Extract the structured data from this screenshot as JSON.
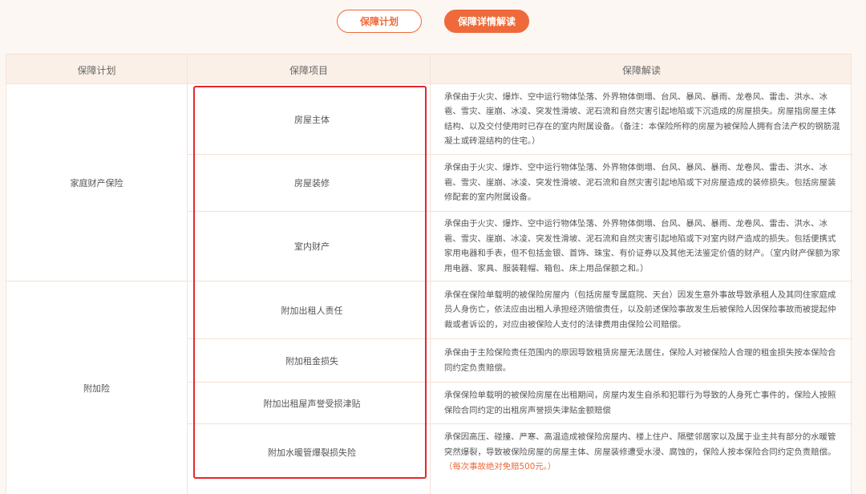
{
  "tabs": {
    "plan_label": "保障计划",
    "detail_label": "保障详情解读"
  },
  "table": {
    "headers": [
      "保障计划",
      "保障项目",
      "保障解读"
    ],
    "groups": [
      {
        "plan": "家庭财产保险"
      },
      {
        "plan": "附加险"
      }
    ],
    "rows": [
      {
        "item": "房屋主体",
        "desc": "承保由于火灾、爆炸、空中运行物体坠落、外界物体倒塌、台风、暴风、暴雨、龙卷风、雷击、洪水、冰雹、雪灾、崖崩、冰凌、突发性滑坡、泥石流和自然灾害引起地陷或下沉造成的房屋损失。房屋指房屋主体结构、以及交付使用时已存在的室内附属设备。（备注：本保险所称的房屋为被保险人拥有合法产权的钢筋混凝土或砖混结构的住宅。）"
      },
      {
        "item": "房屋装修",
        "desc": "承保由于火灾、爆炸、空中运行物体坠落、外界物体倒塌、台风、暴风、暴雨、龙卷风、雷击、洪水、冰雹、雪灾、崖崩、冰凌、突发性滑坡、泥石流和自然灾害引起地陷或下对房屋造成的装修损失。包括房屋装修配套的室内附属设备。"
      },
      {
        "item": "室内财产",
        "desc": "承保由于火灾、爆炸、空中运行物体坠落、外界物体倒塌、台风、暴风、暴雨、龙卷风、雷击、洪水、冰雹、雪灾、崖崩、冰凌、突发性滑坡、泥石流和自然灾害引起地陷或下对室内财产造成的损失。包括便携式家用电器和手表，但不包括金银、首饰、珠宝、有价证券以及其他无法鉴定价值的财产。（室内财产保额为家用电器、家具、服装鞋帽、箱包、床上用品保额之和。）"
      },
      {
        "item": "附加出租人责任",
        "desc": "承保在保险单载明的被保险房屋内（包括房屋专属庭院、天台）因发生意外事故导致承租人及其同住家庭成员人身伤亡，依法应由出租人承担经济赔偿责任，以及前述保险事故发生后被保险人因保险事故而被提起仲裁或者诉讼的，对应由被保险人支付的法律费用由保险公司赔偿。"
      },
      {
        "item": "附加租金损失",
        "desc": "承保由于主险保险责任范围内的原因导致租赁房屋无法居住，保险人对被保险人合理的租金损失按本保险合同约定负责赔偿。"
      },
      {
        "item": "附加出租屋声誉受损津贴",
        "desc": "承保保险单载明的被保险房屋在出租期间，房屋内发生自杀和犯罪行为导致的人身死亡事件的，保险人按照保险合同约定的出租房声誉损失津贴金额赔偿"
      },
      {
        "item": "附加水暖管爆裂损失险",
        "desc": "承保因高压、碰撞、严寒、高温造成被保险房屋内、楼上住户、隔壁邻居家以及属于业主共有部分的水暖管突然爆裂，导致被保险房屋的房屋主体、房屋装修遭受水浸、腐蚀的，保险人按本保险合同约定负责赔偿。",
        "note": "（每次事故绝对免赔500元。）"
      }
    ]
  },
  "colors": {
    "accent": "#ef6a3a",
    "highlight_box": "#e8262c",
    "header_bg": "#fbf0e8",
    "page_bg": "#fdf7f3"
  }
}
